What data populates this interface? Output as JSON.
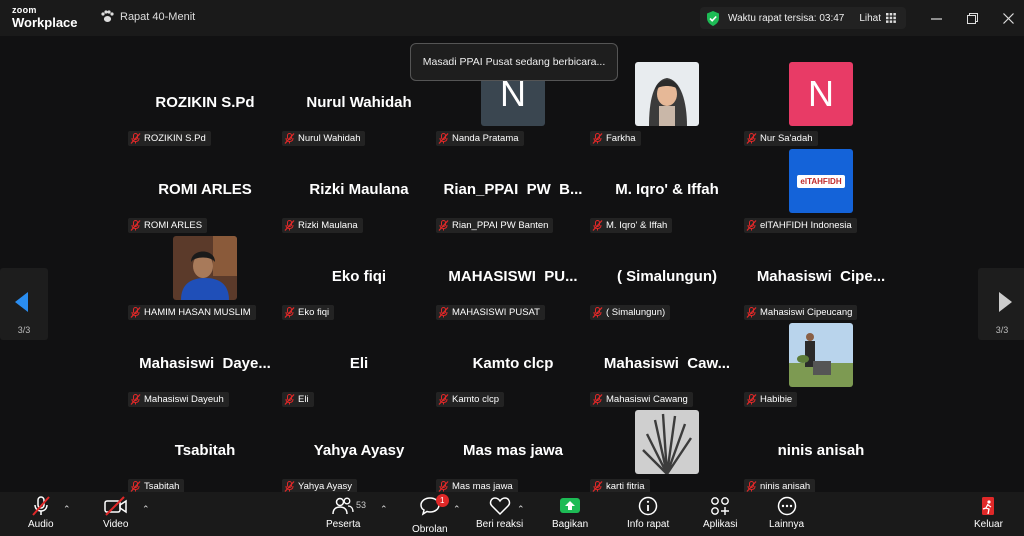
{
  "app": {
    "logo_top": "zoom",
    "logo_bottom": "Workplace"
  },
  "meeting": {
    "title": "Rapat 40-Menit",
    "timer_label": "Waktu rapat tersisa: 03:47",
    "view_label": "Lihat"
  },
  "notification": "Masadi PPAI Pusat sedang berbicara...",
  "pager": {
    "left": "3/3",
    "right": "3/3"
  },
  "participants": [
    {
      "display": "ROZIKIN S.Pd",
      "label": "ROZIKIN S.Pd",
      "type": "name"
    },
    {
      "display": "Nurul Wahidah",
      "label": "Nurul Wahidah",
      "type": "name"
    },
    {
      "display": "N",
      "label": "Nanda Pratama",
      "type": "letter",
      "color": "#3a4650"
    },
    {
      "display": "",
      "label": "Farkha",
      "type": "photo-woman"
    },
    {
      "display": "N",
      "label": "Nur Sa'adah",
      "type": "letter",
      "color": "#e83b66"
    },
    {
      "display": "ROMI ARLES",
      "label": "ROMI ARLES",
      "type": "name"
    },
    {
      "display": "Rizki Maulana",
      "label": "Rizki Maulana",
      "type": "name"
    },
    {
      "display": "Rian_PPAI  PW  B...",
      "label": "Rian_PPAI PW Banten",
      "type": "name"
    },
    {
      "display": "M. Iqro' & Iffah",
      "label": "M. Iqro' & Iffah",
      "type": "name"
    },
    {
      "display": "elTAHFIDH",
      "label": "elTAHFIDH Indonesia",
      "type": "logo"
    },
    {
      "display": "",
      "label": "HAMIM HASAN MUSLIM",
      "type": "photo-man"
    },
    {
      "display": "Eko fiqi",
      "label": "Eko fiqi",
      "type": "name"
    },
    {
      "display": "MAHASISWI  PU...",
      "label": "MAHASISWI PUSAT",
      "type": "name"
    },
    {
      "display": "( Simalungun)",
      "label": "( Simalungun)",
      "type": "name"
    },
    {
      "display": "Mahasiswi  Cipe...",
      "label": "Mahasiswi Cipeucang",
      "type": "name"
    },
    {
      "display": "Mahasiswi  Daye...",
      "label": "Mahasiswi Dayeuh",
      "type": "name"
    },
    {
      "display": "Eli",
      "label": "Eli",
      "type": "name"
    },
    {
      "display": "Kamto clcp",
      "label": "Kamto clcp",
      "type": "name"
    },
    {
      "display": "Mahasiswi  Caw...",
      "label": "Mahasiswi Cawang",
      "type": "name"
    },
    {
      "display": "",
      "label": "Habibie",
      "type": "photo-outdoor"
    },
    {
      "display": "Tsabitah",
      "label": "Tsabitah",
      "type": "name"
    },
    {
      "display": "Yahya Ayasy",
      "label": "Yahya Ayasy",
      "type": "name"
    },
    {
      "display": "Mas mas jawa",
      "label": "Mas mas jawa",
      "type": "name"
    },
    {
      "display": "",
      "label": "karti fitria",
      "type": "photo-plant"
    },
    {
      "display": "ninis anisah",
      "label": "ninis anisah",
      "type": "name"
    }
  ],
  "toolbar": {
    "audio": "Audio",
    "video": "Video",
    "participants": "Peserta",
    "participant_count": "53",
    "chat": "Obrolan",
    "chat_badge": "1",
    "reactions": "Beri reaksi",
    "share": "Bagikan",
    "info": "Info rapat",
    "apps": "Aplikasi",
    "more": "Lainnya",
    "leave": "Keluar"
  },
  "colors": {
    "share_green": "#1dbb55",
    "leave_red": "#e02828",
    "shield_green": "#1dbb55"
  }
}
